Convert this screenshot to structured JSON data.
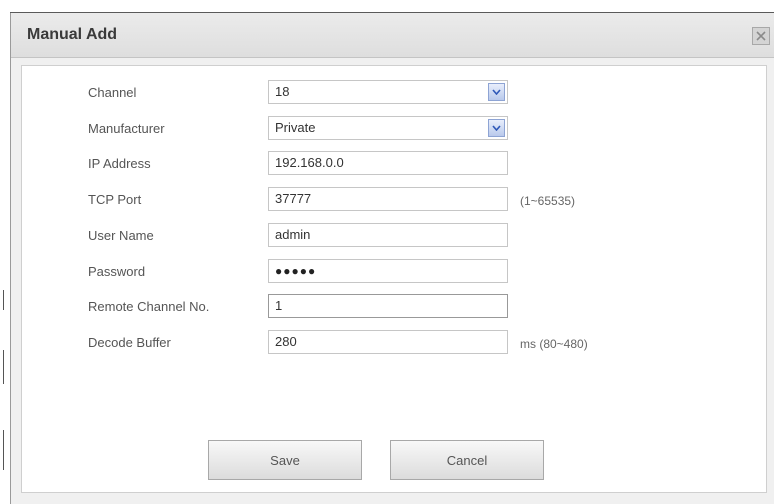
{
  "dialog": {
    "title": "Manual Add",
    "close_icon": "close-icon"
  },
  "form": {
    "channel": {
      "label": "Channel",
      "value": "18"
    },
    "manufacturer": {
      "label": "Manufacturer",
      "value": "Private"
    },
    "ip_address": {
      "label": "IP Address",
      "value": "192.168.0.0"
    },
    "tcp_port": {
      "label": "TCP Port",
      "value": "37777",
      "hint": "(1~65535)"
    },
    "user_name": {
      "label": "User Name",
      "value": "admin"
    },
    "password": {
      "label": "Password",
      "value": "●●●●●"
    },
    "remote_channel": {
      "label": "Remote Channel No.",
      "value": "1"
    },
    "decode_buffer": {
      "label": "Decode Buffer",
      "value": "280",
      "hint": "ms (80~480)"
    }
  },
  "buttons": {
    "save": "Save",
    "cancel": "Cancel"
  },
  "colors": {
    "dropdown_arrow": "#2f58b8",
    "dialog_bg": "#f0f0f0"
  }
}
